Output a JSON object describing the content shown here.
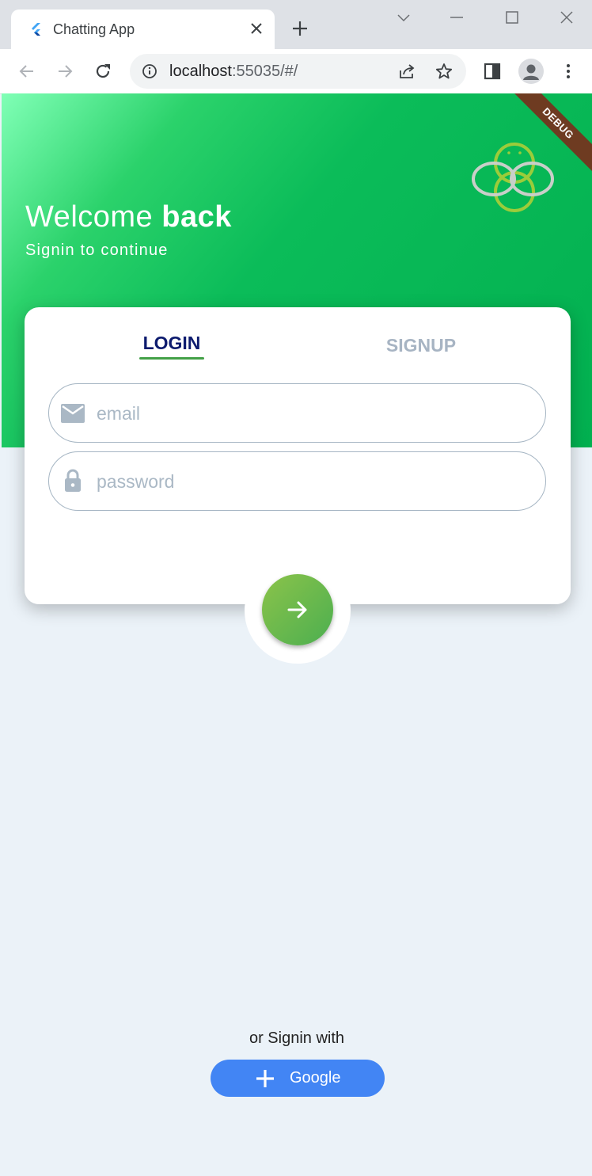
{
  "browser": {
    "tab_title": "Chatting App",
    "url_host": "localhost",
    "url_rest": ":55035/#/",
    "icons": {
      "favicon": "flutter-icon",
      "close": "close-icon",
      "new_tab": "plus-icon",
      "back": "arrow-left-icon",
      "forward": "arrow-right-icon",
      "reload": "reload-icon",
      "info": "info-icon",
      "share": "share-icon",
      "bookmark": "star-icon",
      "side_panel": "side-panel-icon",
      "profile": "avatar-icon",
      "menu": "kebab-menu-icon"
    }
  },
  "hero": {
    "welcome_prefix": "Welcome",
    "welcome_bold": "back",
    "subtitle": "Signin to continue",
    "debug_banner": "DEBUG"
  },
  "auth": {
    "tabs": {
      "login": "LOGIN",
      "signup": "SIGNUP",
      "active": "login"
    },
    "email": {
      "placeholder": "email",
      "value": "",
      "icon": "mail-icon"
    },
    "password": {
      "placeholder": "password",
      "value": "",
      "icon": "lock-icon"
    },
    "submit_icon": "arrow-right-icon"
  },
  "footer": {
    "or_text": "or Signin with",
    "google_label": "Google",
    "google_icon": "plus-icon"
  },
  "colors": {
    "accent_green": "#4caf50",
    "login_tab": "#0d1b6e",
    "inactive_tab": "#a7b4c3",
    "google_blue": "#4285f4"
  }
}
